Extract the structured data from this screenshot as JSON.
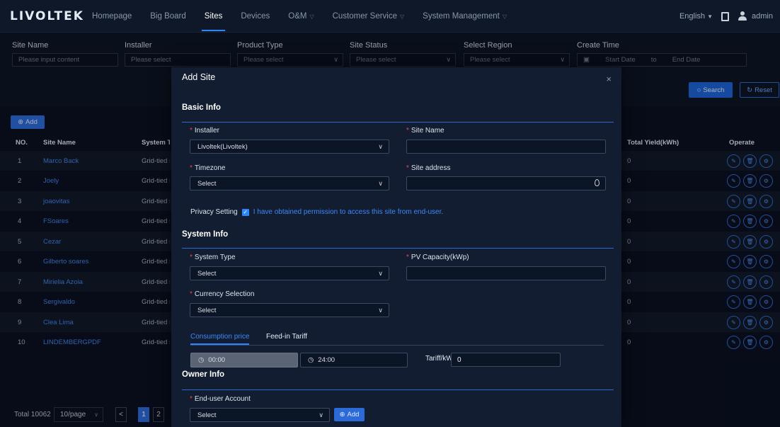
{
  "nav": {
    "logo": "LIVOLTEK",
    "items": [
      {
        "label": "Homepage",
        "active": false,
        "chevron": false
      },
      {
        "label": "Big Board",
        "active": false,
        "chevron": false
      },
      {
        "label": "Sites",
        "active": true,
        "chevron": false
      },
      {
        "label": "Devices",
        "active": false,
        "chevron": false
      },
      {
        "label": "O&M",
        "active": false,
        "chevron": true
      },
      {
        "label": "Customer Service",
        "active": false,
        "chevron": true
      },
      {
        "label": "System Management",
        "active": false,
        "chevron": true
      }
    ],
    "language": "English",
    "user": "admin"
  },
  "filters": {
    "site_name": {
      "label": "Site Name",
      "placeholder": "Please input content"
    },
    "installer": {
      "label": "Installer",
      "placeholder": "Please select"
    },
    "product_type": {
      "label": "Product Type",
      "placeholder": "Please select"
    },
    "site_status": {
      "label": "Site Status",
      "placeholder": "Please select"
    },
    "region": {
      "label": "Select Region",
      "placeholder": "Please select"
    },
    "create_time": {
      "label": "Create Time",
      "start": "Start Date",
      "separator": "to",
      "end": "End Date"
    },
    "search_label": "Search",
    "reset_label": "Reset"
  },
  "table": {
    "add_label": "Add",
    "headers": {
      "no": "NO.",
      "name": "Site Name",
      "type": "System Typ",
      "yield": "Total Yield(kWh)",
      "operate": "Operate"
    },
    "rows": [
      {
        "no": "1",
        "name": "Marco Back",
        "type": "Grid-tied so",
        "yield": "0"
      },
      {
        "no": "2",
        "name": "Joely",
        "type": "Grid-tied so",
        "yield": "0"
      },
      {
        "no": "3",
        "name": "joaovitas",
        "type": "Grid-tied so",
        "yield": "0"
      },
      {
        "no": "4",
        "name": "FSoares",
        "type": "Grid-tied so",
        "yield": "0"
      },
      {
        "no": "5",
        "name": "Cezar",
        "type": "Grid-tied so",
        "yield": "0"
      },
      {
        "no": "6",
        "name": "Gilberto soares",
        "type": "Grid-tied so",
        "yield": "0"
      },
      {
        "no": "7",
        "name": "Mirielia Azoia",
        "type": "Grid-tied so",
        "yield": "0"
      },
      {
        "no": "8",
        "name": "Sergivaldo",
        "type": "Grid-tied so",
        "yield": "0"
      },
      {
        "no": "9",
        "name": "Clea Lima",
        "type": "Grid-tied so",
        "yield": "0"
      },
      {
        "no": "10",
        "name": "LINDEMBERGPDF",
        "type": "Grid-tied so",
        "yield": "0"
      }
    ],
    "pager": {
      "total": "Total 10062",
      "page_size": "10/page",
      "prev": "<",
      "pages": [
        "1",
        "2"
      ]
    }
  },
  "modal": {
    "title": "Add Site",
    "close": "×",
    "basic_info": {
      "title": "Basic Info",
      "installer_label": "Installer",
      "installer_value": "Livoltek(Livoltek)",
      "site_name_label": "Site Name",
      "timezone_label": "Timezone",
      "timezone_value": "Select",
      "address_label": "Site address",
      "privacy_label": "Privacy Setting",
      "privacy_text": "I have obtained permission to access this site from end-user."
    },
    "system_info": {
      "title": "System Info",
      "system_type_label": "System Type",
      "system_type_value": "Select",
      "pv_label": "PV Capacity(kWp)",
      "currency_label": "Currency Selection",
      "currency_value": "Select",
      "tab_consumption": "Consumption price",
      "tab_feedin": "Feed-in Tariff",
      "time_start": "00:00",
      "time_end": "24:00",
      "tariff_label": "Tariff/kWh:",
      "tariff_value": "0"
    },
    "owner_info": {
      "title": "Owner Info",
      "account_label": "End-user Account",
      "account_value": "Select",
      "add_label": "Add"
    }
  }
}
